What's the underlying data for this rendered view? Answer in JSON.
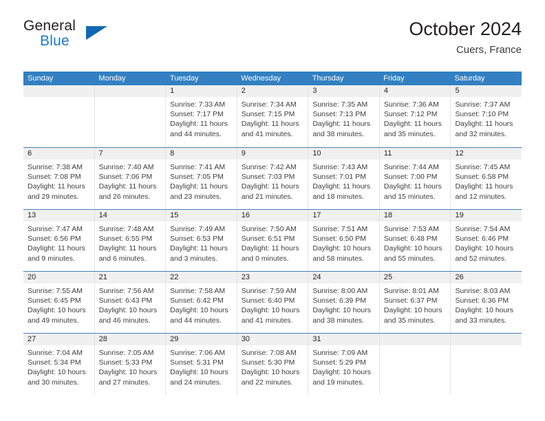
{
  "brand": {
    "name_part1": "General",
    "name_part2": "Blue",
    "triangle_icon": "brand-triangle-icon",
    "colors": {
      "dark_text": "#231f20",
      "blue_text": "#1b79c4",
      "triangle": "#1268b3"
    }
  },
  "header": {
    "title": "October 2024",
    "location": "Cuers, France"
  },
  "colors": {
    "header_band": "#3280c2",
    "daynum_band": "#f0f0f0",
    "week_separator": "#4a7ebb",
    "column_divider": "#e4e4e4"
  },
  "weekdays": [
    {
      "label": "Sunday"
    },
    {
      "label": "Monday"
    },
    {
      "label": "Tuesday"
    },
    {
      "label": "Wednesday"
    },
    {
      "label": "Thursday"
    },
    {
      "label": "Friday"
    },
    {
      "label": "Saturday"
    }
  ],
  "weeks": [
    {
      "days": [
        {
          "daynum": "",
          "blank": true,
          "sunrise": "",
          "sunset": "",
          "daylight1": "",
          "daylight2": ""
        },
        {
          "daynum": "",
          "blank": true,
          "sunrise": "",
          "sunset": "",
          "daylight1": "",
          "daylight2": ""
        },
        {
          "daynum": "1",
          "blank": false,
          "sunrise": "Sunrise: 7:33 AM",
          "sunset": "Sunset: 7:17 PM",
          "daylight1": "Daylight: 11 hours",
          "daylight2": "and 44 minutes."
        },
        {
          "daynum": "2",
          "blank": false,
          "sunrise": "Sunrise: 7:34 AM",
          "sunset": "Sunset: 7:15 PM",
          "daylight1": "Daylight: 11 hours",
          "daylight2": "and 41 minutes."
        },
        {
          "daynum": "3",
          "blank": false,
          "sunrise": "Sunrise: 7:35 AM",
          "sunset": "Sunset: 7:13 PM",
          "daylight1": "Daylight: 11 hours",
          "daylight2": "and 38 minutes."
        },
        {
          "daynum": "4",
          "blank": false,
          "sunrise": "Sunrise: 7:36 AM",
          "sunset": "Sunset: 7:12 PM",
          "daylight1": "Daylight: 11 hours",
          "daylight2": "and 35 minutes."
        },
        {
          "daynum": "5",
          "blank": false,
          "sunrise": "Sunrise: 7:37 AM",
          "sunset": "Sunset: 7:10 PM",
          "daylight1": "Daylight: 11 hours",
          "daylight2": "and 32 minutes."
        }
      ]
    },
    {
      "days": [
        {
          "daynum": "6",
          "blank": false,
          "sunrise": "Sunrise: 7:38 AM",
          "sunset": "Sunset: 7:08 PM",
          "daylight1": "Daylight: 11 hours",
          "daylight2": "and 29 minutes."
        },
        {
          "daynum": "7",
          "blank": false,
          "sunrise": "Sunrise: 7:40 AM",
          "sunset": "Sunset: 7:06 PM",
          "daylight1": "Daylight: 11 hours",
          "daylight2": "and 26 minutes."
        },
        {
          "daynum": "8",
          "blank": false,
          "sunrise": "Sunrise: 7:41 AM",
          "sunset": "Sunset: 7:05 PM",
          "daylight1": "Daylight: 11 hours",
          "daylight2": "and 23 minutes."
        },
        {
          "daynum": "9",
          "blank": false,
          "sunrise": "Sunrise: 7:42 AM",
          "sunset": "Sunset: 7:03 PM",
          "daylight1": "Daylight: 11 hours",
          "daylight2": "and 21 minutes."
        },
        {
          "daynum": "10",
          "blank": false,
          "sunrise": "Sunrise: 7:43 AM",
          "sunset": "Sunset: 7:01 PM",
          "daylight1": "Daylight: 11 hours",
          "daylight2": "and 18 minutes."
        },
        {
          "daynum": "11",
          "blank": false,
          "sunrise": "Sunrise: 7:44 AM",
          "sunset": "Sunset: 7:00 PM",
          "daylight1": "Daylight: 11 hours",
          "daylight2": "and 15 minutes."
        },
        {
          "daynum": "12",
          "blank": false,
          "sunrise": "Sunrise: 7:45 AM",
          "sunset": "Sunset: 6:58 PM",
          "daylight1": "Daylight: 11 hours",
          "daylight2": "and 12 minutes."
        }
      ]
    },
    {
      "days": [
        {
          "daynum": "13",
          "blank": false,
          "sunrise": "Sunrise: 7:47 AM",
          "sunset": "Sunset: 6:56 PM",
          "daylight1": "Daylight: 11 hours",
          "daylight2": "and 9 minutes."
        },
        {
          "daynum": "14",
          "blank": false,
          "sunrise": "Sunrise: 7:48 AM",
          "sunset": "Sunset: 6:55 PM",
          "daylight1": "Daylight: 11 hours",
          "daylight2": "and 6 minutes."
        },
        {
          "daynum": "15",
          "blank": false,
          "sunrise": "Sunrise: 7:49 AM",
          "sunset": "Sunset: 6:53 PM",
          "daylight1": "Daylight: 11 hours",
          "daylight2": "and 3 minutes."
        },
        {
          "daynum": "16",
          "blank": false,
          "sunrise": "Sunrise: 7:50 AM",
          "sunset": "Sunset: 6:51 PM",
          "daylight1": "Daylight: 11 hours",
          "daylight2": "and 0 minutes."
        },
        {
          "daynum": "17",
          "blank": false,
          "sunrise": "Sunrise: 7:51 AM",
          "sunset": "Sunset: 6:50 PM",
          "daylight1": "Daylight: 10 hours",
          "daylight2": "and 58 minutes."
        },
        {
          "daynum": "18",
          "blank": false,
          "sunrise": "Sunrise: 7:53 AM",
          "sunset": "Sunset: 6:48 PM",
          "daylight1": "Daylight: 10 hours",
          "daylight2": "and 55 minutes."
        },
        {
          "daynum": "19",
          "blank": false,
          "sunrise": "Sunrise: 7:54 AM",
          "sunset": "Sunset: 6:46 PM",
          "daylight1": "Daylight: 10 hours",
          "daylight2": "and 52 minutes."
        }
      ]
    },
    {
      "days": [
        {
          "daynum": "20",
          "blank": false,
          "sunrise": "Sunrise: 7:55 AM",
          "sunset": "Sunset: 6:45 PM",
          "daylight1": "Daylight: 10 hours",
          "daylight2": "and 49 minutes."
        },
        {
          "daynum": "21",
          "blank": false,
          "sunrise": "Sunrise: 7:56 AM",
          "sunset": "Sunset: 6:43 PM",
          "daylight1": "Daylight: 10 hours",
          "daylight2": "and 46 minutes."
        },
        {
          "daynum": "22",
          "blank": false,
          "sunrise": "Sunrise: 7:58 AM",
          "sunset": "Sunset: 6:42 PM",
          "daylight1": "Daylight: 10 hours",
          "daylight2": "and 44 minutes."
        },
        {
          "daynum": "23",
          "blank": false,
          "sunrise": "Sunrise: 7:59 AM",
          "sunset": "Sunset: 6:40 PM",
          "daylight1": "Daylight: 10 hours",
          "daylight2": "and 41 minutes."
        },
        {
          "daynum": "24",
          "blank": false,
          "sunrise": "Sunrise: 8:00 AM",
          "sunset": "Sunset: 6:39 PM",
          "daylight1": "Daylight: 10 hours",
          "daylight2": "and 38 minutes."
        },
        {
          "daynum": "25",
          "blank": false,
          "sunrise": "Sunrise: 8:01 AM",
          "sunset": "Sunset: 6:37 PM",
          "daylight1": "Daylight: 10 hours",
          "daylight2": "and 35 minutes."
        },
        {
          "daynum": "26",
          "blank": false,
          "sunrise": "Sunrise: 8:03 AM",
          "sunset": "Sunset: 6:36 PM",
          "daylight1": "Daylight: 10 hours",
          "daylight2": "and 33 minutes."
        }
      ]
    },
    {
      "days": [
        {
          "daynum": "27",
          "blank": false,
          "sunrise": "Sunrise: 7:04 AM",
          "sunset": "Sunset: 5:34 PM",
          "daylight1": "Daylight: 10 hours",
          "daylight2": "and 30 minutes."
        },
        {
          "daynum": "28",
          "blank": false,
          "sunrise": "Sunrise: 7:05 AM",
          "sunset": "Sunset: 5:33 PM",
          "daylight1": "Daylight: 10 hours",
          "daylight2": "and 27 minutes."
        },
        {
          "daynum": "29",
          "blank": false,
          "sunrise": "Sunrise: 7:06 AM",
          "sunset": "Sunset: 5:31 PM",
          "daylight1": "Daylight: 10 hours",
          "daylight2": "and 24 minutes."
        },
        {
          "daynum": "30",
          "blank": false,
          "sunrise": "Sunrise: 7:08 AM",
          "sunset": "Sunset: 5:30 PM",
          "daylight1": "Daylight: 10 hours",
          "daylight2": "and 22 minutes."
        },
        {
          "daynum": "31",
          "blank": false,
          "sunrise": "Sunrise: 7:09 AM",
          "sunset": "Sunset: 5:29 PM",
          "daylight1": "Daylight: 10 hours",
          "daylight2": "and 19 minutes."
        },
        {
          "daynum": "",
          "blank": true,
          "sunrise": "",
          "sunset": "",
          "daylight1": "",
          "daylight2": ""
        },
        {
          "daynum": "",
          "blank": true,
          "sunrise": "",
          "sunset": "",
          "daylight1": "",
          "daylight2": ""
        }
      ]
    }
  ]
}
